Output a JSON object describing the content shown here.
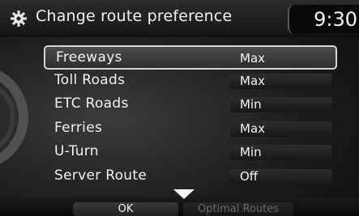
{
  "header": {
    "title": "Change route preference",
    "clock": "9:30",
    "settings_icon": "gear-icon"
  },
  "route_options": [
    {
      "label": "Freeways",
      "value": "Max"
    },
    {
      "label": "Toll Roads",
      "value": "Max"
    },
    {
      "label": "ETC Roads",
      "value": "Min"
    },
    {
      "label": "Ferries",
      "value": "Max"
    },
    {
      "label": "U-Turn",
      "value": "Min"
    },
    {
      "label": "Server Route",
      "value": "Off"
    }
  ],
  "selected_index": 0,
  "footer": {
    "ok_label": "OK",
    "optimal_routes_label": "Optimal Routes",
    "scroll_icon": "chevron-down-icon"
  },
  "colors": {
    "background": "#1c1c1c",
    "text": "#f2f2f2",
    "selected_border": "#d6d6d6",
    "disabled_text": "#6a6a6a"
  }
}
